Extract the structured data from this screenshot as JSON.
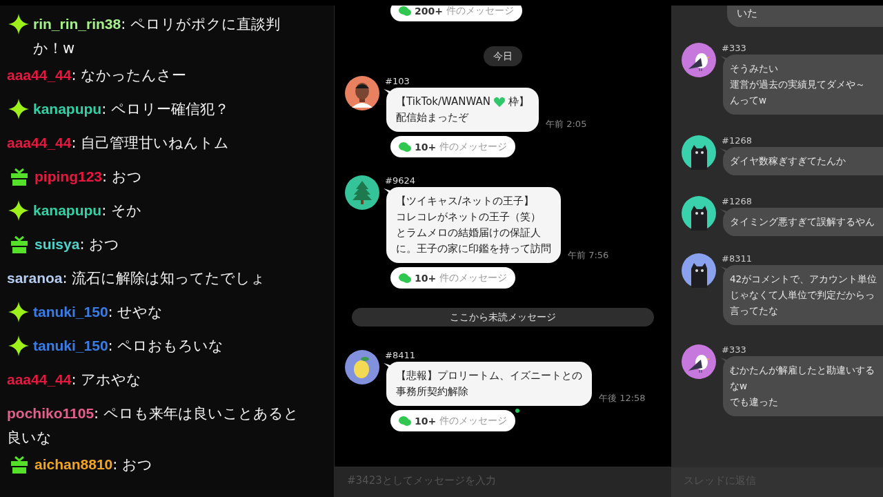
{
  "live_chat": {
    "messages": [
      {
        "kind": "diamond",
        "user": "rin_rin_rin38",
        "color": "#a6f08a",
        "text": ": ペロリがポクに直談判か！w"
      },
      {
        "kind": "plain",
        "user": "aaa44_44",
        "color": "#e8173f",
        "text": ": なかったんさー"
      },
      {
        "kind": "diamond",
        "user": "kanapupu",
        "color": "#2fd3a6",
        "text": ": ペロリー確信犯？"
      },
      {
        "kind": "plain",
        "user": "aaa44_44",
        "color": "#e8173f",
        "text": ": 自己管理甘いねんトム"
      },
      {
        "kind": "gift",
        "user": "piping123",
        "color": "#e8173f",
        "text": ": おつ"
      },
      {
        "kind": "diamond",
        "user": "kanapupu",
        "color": "#2fd3a6",
        "text": ": そか"
      },
      {
        "kind": "gift",
        "user": "suisya",
        "color": "#4fd2c8",
        "text": ": おつ"
      },
      {
        "kind": "plain",
        "user": "saranoa",
        "color": "#b6cdf2",
        "text": ": 流石に解除は知ってたでしょ"
      },
      {
        "kind": "diamond",
        "user": "tanuki_150",
        "color": "#3a7de6",
        "text": ": せやな"
      },
      {
        "kind": "diamond",
        "user": "tanuki_150",
        "color": "#3a7de6",
        "text": ": ペロおもろいな"
      },
      {
        "kind": "plain",
        "user": "aaa44_44",
        "color": "#e8173f",
        "text": ": アホやな"
      },
      {
        "kind": "plain",
        "user": "pochiko1105",
        "color": "#e45f8c",
        "text": ": ペロも来年は良いことあると良いな"
      },
      {
        "kind": "gift",
        "user": "aichan8810",
        "color": "#f2a51e",
        "text": ": おつ"
      }
    ]
  },
  "open_chat": {
    "top_replies": "200+件のメッセージ",
    "date": "今日",
    "messages": [
      {
        "kind": "message",
        "avatar": {
          "kind": "person"
        },
        "id": "#103",
        "lines": [
          [
            {
              "kind": "text",
              "text": "【TikTok/WANWAN"
            },
            {
              "kind": "heart"
            },
            {
              "kind": "text",
              "text": "枠】"
            }
          ],
          [
            {
              "kind": "text",
              "text": "配信始まったぞ"
            }
          ]
        ],
        "time": "午前 2:05",
        "replies": "10+件のメッセージ",
        "new": false
      },
      {
        "kind": "message",
        "avatar": {
          "kind": "tree"
        },
        "id": "#9624",
        "lines": [
          [
            {
              "kind": "text",
              "text": "【ツイキャス/ネットの王子】"
            }
          ],
          [
            {
              "kind": "text",
              "text": "コレコレがネットの王子（笑）"
            }
          ],
          [
            {
              "kind": "text",
              "text": "とラムメロの結婚届けの保証人"
            }
          ],
          [
            {
              "kind": "text",
              "text": "に。王子の家に印鑑を持って訪問"
            }
          ]
        ],
        "time": "午前 7:56",
        "replies": "10+件のメッセージ",
        "new": false
      },
      {
        "kind": "divider",
        "text": "ここから未読メッセージ"
      },
      {
        "kind": "message",
        "avatar": {
          "kind": "lemon"
        },
        "id": "#8411",
        "lines": [
          [
            {
              "kind": "text",
              "text": "【悲報】プロリートム、イズニートとの"
            }
          ],
          [
            {
              "kind": "text",
              "text": "事務所契約解除"
            }
          ]
        ],
        "time": "午後 12:58",
        "replies": "10+件のメッセージ",
        "new": true
      }
    ],
    "input": {
      "placeholder": "#3423としてメッセージを入力"
    }
  },
  "thread": {
    "top_text": "いた",
    "messages": [
      {
        "avatar": {
          "kind": "bird"
        },
        "id": "#333",
        "lines": [
          "そうみたい",
          "運営が過去の実績見てダメや～",
          "んってw"
        ]
      },
      {
        "avatar": {
          "kind": "cat-teal"
        },
        "id": "#1268",
        "lines": [
          "ダイヤ数稼ぎすぎてたんか"
        ]
      },
      {
        "avatar": {
          "kind": "cat-teal"
        },
        "id": "#1268",
        "lines": [
          "タイミング悪すぎて誤解するやん"
        ]
      },
      {
        "avatar": {
          "kind": "cat-blue"
        },
        "id": "#8311",
        "lines": [
          "42がコメントで、アカウント単位",
          "じゃなくて人単位で判定だからっ",
          "言ってたな"
        ]
      },
      {
        "avatar": {
          "kind": "bird"
        },
        "id": "#333",
        "lines": [
          "むかたんが解雇したと勘違いする",
          "なw",
          "でも違った"
        ]
      }
    ],
    "input": {
      "placeholder": "スレッドに返信"
    }
  }
}
